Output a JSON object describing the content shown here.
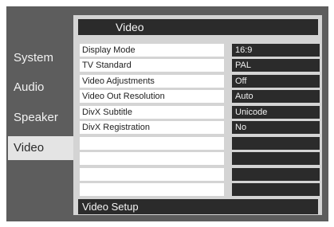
{
  "sidebar": {
    "items": [
      {
        "label": "System"
      },
      {
        "label": "Audio"
      },
      {
        "label": "Speaker"
      },
      {
        "label": "Video"
      }
    ]
  },
  "panel": {
    "title": "Video",
    "rows": [
      {
        "label": "Display Mode",
        "value": "16:9"
      },
      {
        "label": "TV Standard",
        "value": "PAL"
      },
      {
        "label": "Video Adjustments",
        "value": "Off"
      },
      {
        "label": "Video Out Resolution",
        "value": "Auto"
      },
      {
        "label": "DivX Subtitle",
        "value": "Unicode"
      },
      {
        "label": "DivX Registration",
        "value": "No"
      },
      {
        "label": "",
        "value": ""
      },
      {
        "label": "",
        "value": ""
      },
      {
        "label": "",
        "value": ""
      },
      {
        "label": "",
        "value": ""
      }
    ],
    "footer": "Video Setup"
  }
}
